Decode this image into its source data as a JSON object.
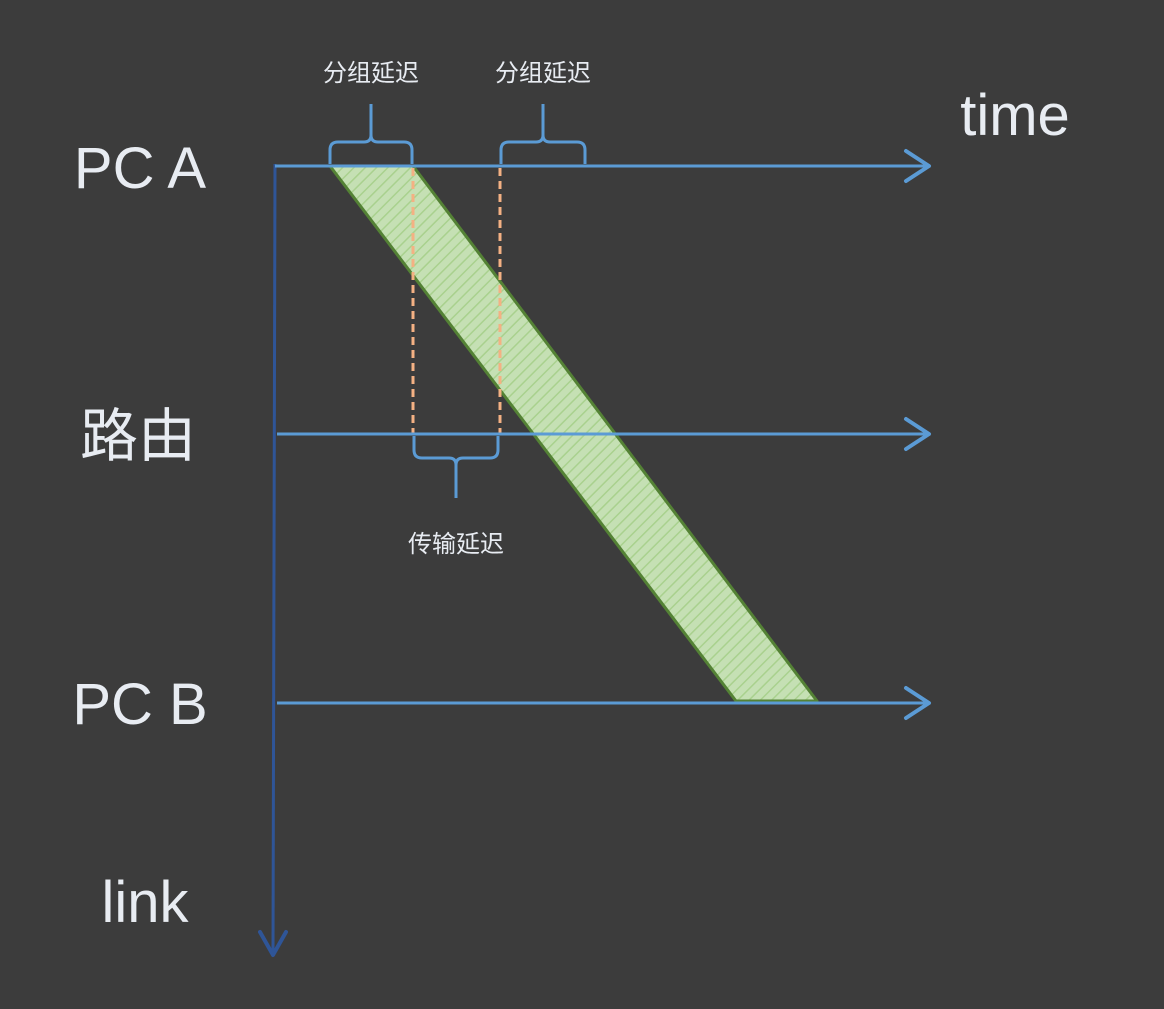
{
  "labels": {
    "pc_a": "PC A",
    "router": "路由",
    "pc_b": "PC B",
    "time_axis": "time",
    "link_axis": "link"
  },
  "annotations": {
    "packet_delay_1": "分组延迟",
    "packet_delay_2": "分组延迟",
    "transmission_delay": "传输延迟"
  },
  "colors": {
    "background": "#3c3c3c",
    "timeline": "#5b9bd5",
    "link_axis": "#2f5597",
    "packet_fill": "#c5e0b4",
    "packet_edge": "#548235",
    "guide_dashed": "#f4b183",
    "brace": "#5b9bd5",
    "text": "#e8ecf2"
  }
}
